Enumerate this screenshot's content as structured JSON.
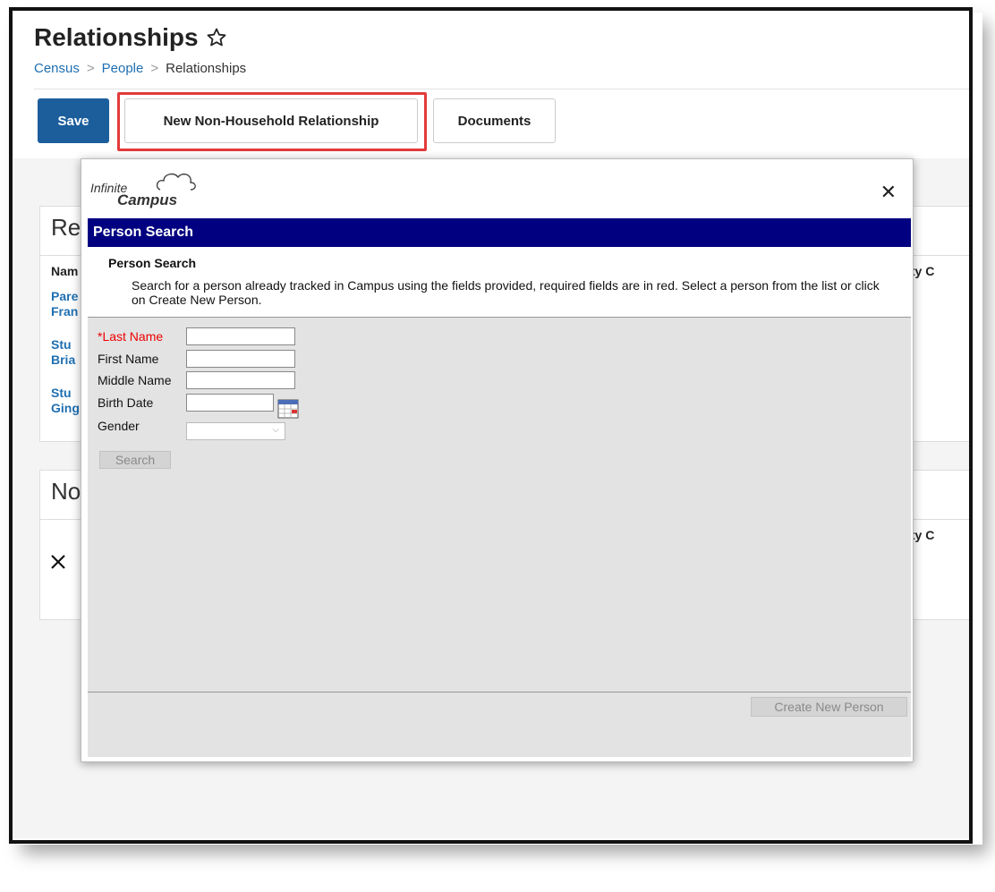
{
  "page": {
    "title": "Relationships",
    "breadcrumbs": [
      "Census",
      "People",
      "Relationships"
    ]
  },
  "toolbar": {
    "save": "Save",
    "new_non_household": "New Non-Household Relationship",
    "documents": "Documents"
  },
  "background_cards": {
    "card1_title_partial": "Re",
    "card1_col_name_partial": "Nam",
    "card1_col_right_partial": "ority C",
    "card1_links": [
      {
        "line1": "Pare",
        "line2": "Fran"
      },
      {
        "line1": "Stu",
        "line2": "Bria"
      },
      {
        "line1": "Stu",
        "line2": "Ging"
      }
    ],
    "card2_title_partial": "No",
    "card2_col_right_partial": "ority C"
  },
  "modal": {
    "logo_line1": "Infinite",
    "logo_line2": "Campus",
    "header": "Person Search",
    "subtitle": "Person Search",
    "description": "Search for a person already tracked in Campus using the fields provided, required fields are in red. Select a person from the list or click on Create New Person.",
    "fields": {
      "last_name": "*Last Name",
      "first_name": "First Name",
      "middle_name": "Middle Name",
      "birth_date": "Birth Date",
      "gender": "Gender"
    },
    "search_button": "Search",
    "create_new_button": "Create New Person"
  },
  "colors": {
    "primary": "#1c5e9c",
    "link": "#1f6fb2",
    "highlight": "#e23b3b",
    "modal_header": "#000080",
    "required": "#e00000"
  }
}
